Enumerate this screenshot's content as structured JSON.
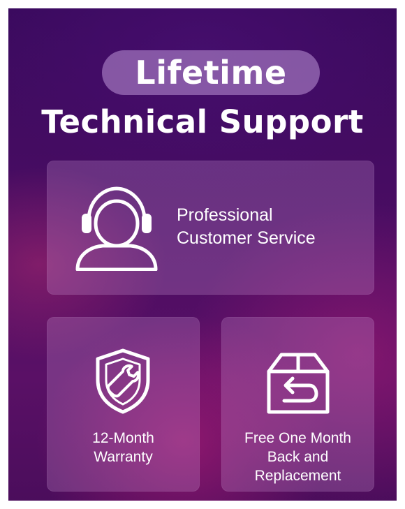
{
  "banner": {
    "pill_text": "Lifetime",
    "headline": "Technical Support"
  },
  "features": {
    "customer_service": {
      "icon": "headset-agent-icon",
      "line1": "Professional",
      "line2": "Customer Service"
    },
    "warranty": {
      "icon": "shield-wrench-icon",
      "line1": "12-Month",
      "line2": "Warranty"
    },
    "replacement": {
      "icon": "return-box-icon",
      "line1": "Free One Month",
      "line2": "Back and",
      "line3": "Replacement"
    }
  },
  "colors": {
    "background": "#4a0d63",
    "accent_magenta": "#b81e78",
    "pill": "#be96d7",
    "text": "#ffffff"
  }
}
